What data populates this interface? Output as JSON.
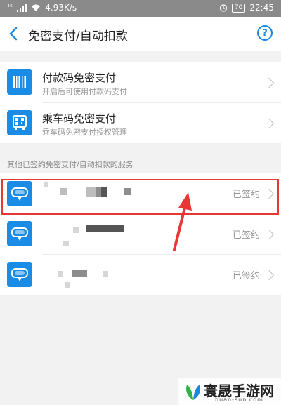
{
  "status_bar": {
    "signal": "⁴⁶",
    "speed": "4.93K/s",
    "battery": "70",
    "time": "22:45"
  },
  "nav": {
    "title": "免密支付/自动扣款",
    "help": "?"
  },
  "main_items": [
    {
      "title": "付款码免密支付",
      "subtitle": "开启后可使用付款码支付",
      "icon": "barcode-icon"
    },
    {
      "title": "乘车码免密支付",
      "subtitle": "乘车码免密支付授权管理",
      "icon": "qrcode-bus-icon"
    }
  ],
  "section_label": "其他已签约免密支付/自动扣款的服务",
  "services": [
    {
      "status": "已签约",
      "icon": "service-icon"
    },
    {
      "status": "已签约",
      "icon": "service-icon"
    },
    {
      "status": "已签约",
      "icon": "service-icon"
    }
  ],
  "watermark": {
    "brand": "寰晟手游网",
    "url": "huan-sun.com"
  },
  "colors": {
    "accent": "#1a8ce5",
    "highlight": "#e53935"
  }
}
